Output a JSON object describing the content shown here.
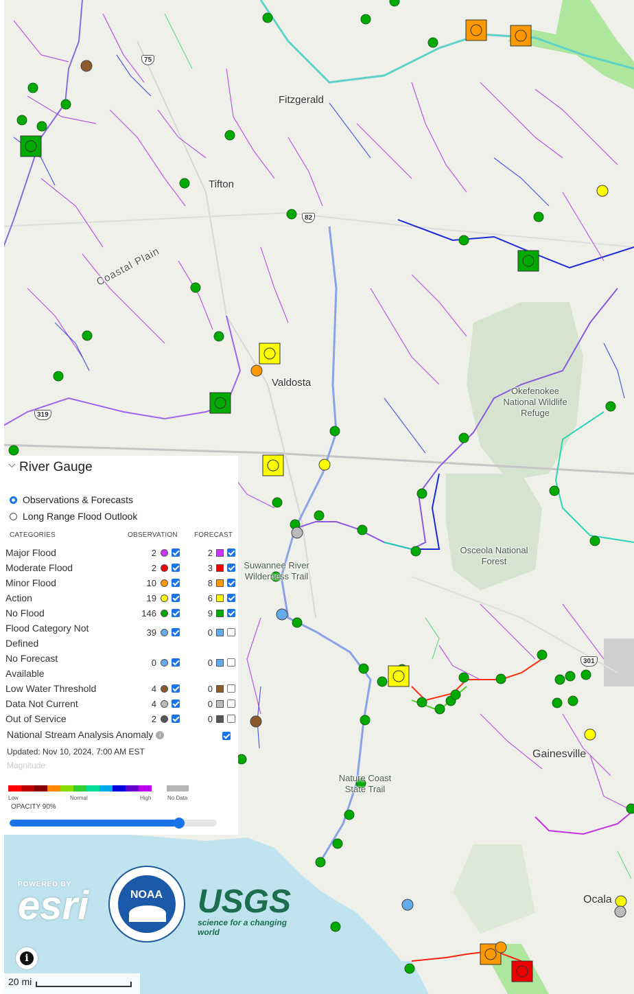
{
  "map": {
    "cities": [
      {
        "name": "Fitzgerald"
      },
      {
        "name": "Tifton"
      },
      {
        "name": "Valdosta"
      },
      {
        "name": "Gainesville"
      },
      {
        "name": "Ocala"
      }
    ],
    "areas": [
      {
        "name": "Coastal Plain"
      },
      {
        "name": "Okefenokee National Wildlife Refuge"
      },
      {
        "name": "Osceola National Forest"
      },
      {
        "name": "Suwannee River Wilderness Trail"
      },
      {
        "name": "Nature Coast State Trail"
      }
    ],
    "highways": [
      "75",
      "82",
      "319",
      "301"
    ]
  },
  "panel": {
    "title": "River Gauge",
    "modes": [
      {
        "label": "Observations & Forecasts",
        "selected": true
      },
      {
        "label": "Long Range Flood Outlook",
        "selected": false
      }
    ],
    "headers": {
      "categories": "CATEGORIES",
      "observation": "OBSERVATION",
      "forecast": "FORECAST"
    },
    "categories": [
      {
        "name": "Major Flood",
        "obs_count": "2",
        "fc_count": "2",
        "color": "#cc33ff",
        "obs_on": true,
        "fc_on": true
      },
      {
        "name": "Moderate Flood",
        "obs_count": "2",
        "fc_count": "3",
        "color": "#ee0000",
        "obs_on": true,
        "fc_on": true
      },
      {
        "name": "Minor Flood",
        "obs_count": "10",
        "fc_count": "8",
        "color": "#ff9900",
        "obs_on": true,
        "fc_on": true
      },
      {
        "name": "Action",
        "obs_count": "19",
        "fc_count": "6",
        "color": "#ffff00",
        "obs_on": true,
        "fc_on": true
      },
      {
        "name": "No Flood",
        "obs_count": "146",
        "fc_count": "9",
        "color": "#00aa00",
        "obs_on": true,
        "fc_on": true
      },
      {
        "name": "Flood Category Not Defined",
        "obs_count": "39",
        "fc_count": "0",
        "color": "#66aaee",
        "obs_on": true,
        "fc_on": false
      },
      {
        "name": "No Forecast Available",
        "obs_count": "0",
        "fc_count": "0",
        "color": "#66aaee",
        "obs_on": true,
        "fc_on": false
      },
      {
        "name": "Low Water Threshold",
        "obs_count": "4",
        "fc_count": "0",
        "color": "#8b5a2b",
        "obs_on": true,
        "fc_on": false
      },
      {
        "name": "Data Not Current",
        "obs_count": "4",
        "fc_count": "0",
        "color": "#bbbbbb",
        "obs_on": true,
        "fc_on": false
      },
      {
        "name": "Out of Service",
        "obs_count": "2",
        "fc_count": "0",
        "color": "#555555",
        "obs_on": true,
        "fc_on": false
      }
    ],
    "nsa": {
      "label": "National Stream Analysis Anomaly",
      "checked": true
    },
    "updated": "Updated: Nov 10, 2024, 7:00 AM EST",
    "magnitude": "Magnitude",
    "ramp_colors": [
      "#ff0000",
      "#bb0000",
      "#880000",
      "#ff8800",
      "#88dd00",
      "#33cc33",
      "#00dd99",
      "#00aaee",
      "#0000dd",
      "#6600cc",
      "#bb00ee"
    ],
    "ramp_labels": {
      "low": "Low",
      "normal": "Normal",
      "high": "High",
      "nodata": "No Data"
    },
    "opacity_label": "OPACITY 90%",
    "opacity": 0.9
  },
  "logos": {
    "esri_tag": "POWERED BY",
    "esri": "esri",
    "noaa": "NOAA",
    "usgs": "USGS",
    "usgs_tag": "science for a changing world"
  },
  "scale": {
    "label": "20 mi"
  },
  "gauges": [
    {
      "shape": "circle",
      "cat": "No Flood"
    },
    {
      "shape": "circle",
      "cat": "No Flood"
    },
    {
      "shape": "square",
      "cat": "Minor Flood"
    },
    {
      "shape": "square",
      "cat": "Minor Flood"
    },
    {
      "shape": "circle",
      "cat": "Low Water Threshold"
    },
    {
      "shape": "square",
      "cat": "No Flood"
    },
    {
      "shape": "circle",
      "cat": "Action"
    },
    {
      "shape": "square",
      "cat": "No Flood"
    },
    {
      "shape": "square",
      "cat": "Action"
    },
    {
      "shape": "circle",
      "cat": "Minor Flood"
    },
    {
      "shape": "square",
      "cat": "No Flood"
    },
    {
      "shape": "square",
      "cat": "Action"
    },
    {
      "shape": "circle",
      "cat": "Action"
    },
    {
      "shape": "circle",
      "cat": "Data Not Current"
    },
    {
      "shape": "circle",
      "cat": "Flood Category Not Defined"
    },
    {
      "shape": "square",
      "cat": "Action"
    },
    {
      "shape": "circle",
      "cat": "Low Water Threshold"
    },
    {
      "shape": "circle",
      "cat": "Action"
    },
    {
      "shape": "circle",
      "cat": "Action"
    },
    {
      "shape": "circle",
      "cat": "Data Not Current"
    },
    {
      "shape": "circle",
      "cat": "Flood Category Not Defined"
    },
    {
      "shape": "square",
      "cat": "Minor Flood"
    },
    {
      "shape": "circle",
      "cat": "Minor Flood"
    },
    {
      "shape": "square",
      "cat": "Moderate Flood"
    }
  ]
}
